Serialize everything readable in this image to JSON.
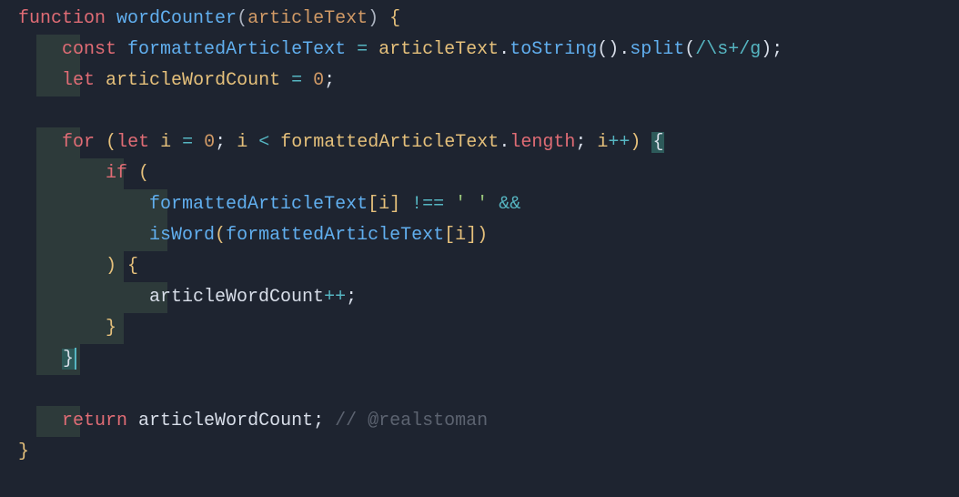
{
  "code": {
    "l1": {
      "kw": "function",
      "name": "wordCounter",
      "open": "(",
      "param": "articleText",
      "close": ")",
      "brace": "{"
    },
    "l2": {
      "kw": "const",
      "var": "formattedArticleText",
      "eq": "=",
      "obj": "articleText",
      "dot1": ".",
      "m1": "toString",
      "p1": "()",
      "dot2": ".",
      "m2": "split",
      "p2o": "(",
      "regex": "/\\s+/g",
      "p2c": ")",
      "semi": ";"
    },
    "l3": {
      "kw": "let",
      "var": "articleWordCount",
      "eq": "=",
      "num": "0",
      "semi": ";"
    },
    "l5": {
      "kw_for": "for",
      "open": "(",
      "kw_let": "let",
      "i1": "i",
      "eq": "=",
      "zero": "0",
      "semi1": ";",
      "i2": "i",
      "lt": "<",
      "arr": "formattedArticleText",
      "dot": ".",
      "len": "length",
      "semi2": ";",
      "i3": "i",
      "inc": "++",
      "close": ")",
      "brace": "{"
    },
    "l6": {
      "kw": "if",
      "open": "("
    },
    "l7": {
      "arr": "formattedArticleText",
      "bo": "[",
      "i": "i",
      "bc": "]",
      "neq": "!==",
      "str": "' '",
      "and": "&&"
    },
    "l8": {
      "fn": "isWord",
      "open": "(",
      "arr": "formattedArticleText",
      "bo": "[",
      "i": "i",
      "bc": "]",
      "close": ")"
    },
    "l9": {
      "close": ")",
      "brace": "{"
    },
    "l10": {
      "var": "articleWordCount",
      "inc": "++",
      "semi": ";"
    },
    "l11": {
      "brace": "}"
    },
    "l12": {
      "brace": "}"
    },
    "l14": {
      "kw": "return",
      "var": "articleWordCount",
      "semi": ";",
      "comment": "// @realstoman"
    },
    "l15": {
      "brace": "}"
    }
  }
}
